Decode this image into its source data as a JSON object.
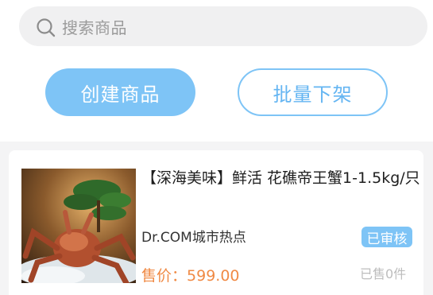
{
  "search": {
    "placeholder": "搜索商品",
    "icon": "search-icon"
  },
  "actions": {
    "create_label": "创建商品",
    "offshelf_label": "批量下架"
  },
  "product": {
    "image": "king-crab-photo",
    "title": "【深海美味】鲜活 花礁帝王蟹1-1.5kg/只",
    "shop": "Dr.COM城市热点",
    "status": "已审核",
    "price_label": "售价：",
    "price": "599.00",
    "sold": "已售0件"
  },
  "colors": {
    "accent": "#7ec4f6",
    "price": "#f08a45",
    "background": "#f4f4f5"
  }
}
